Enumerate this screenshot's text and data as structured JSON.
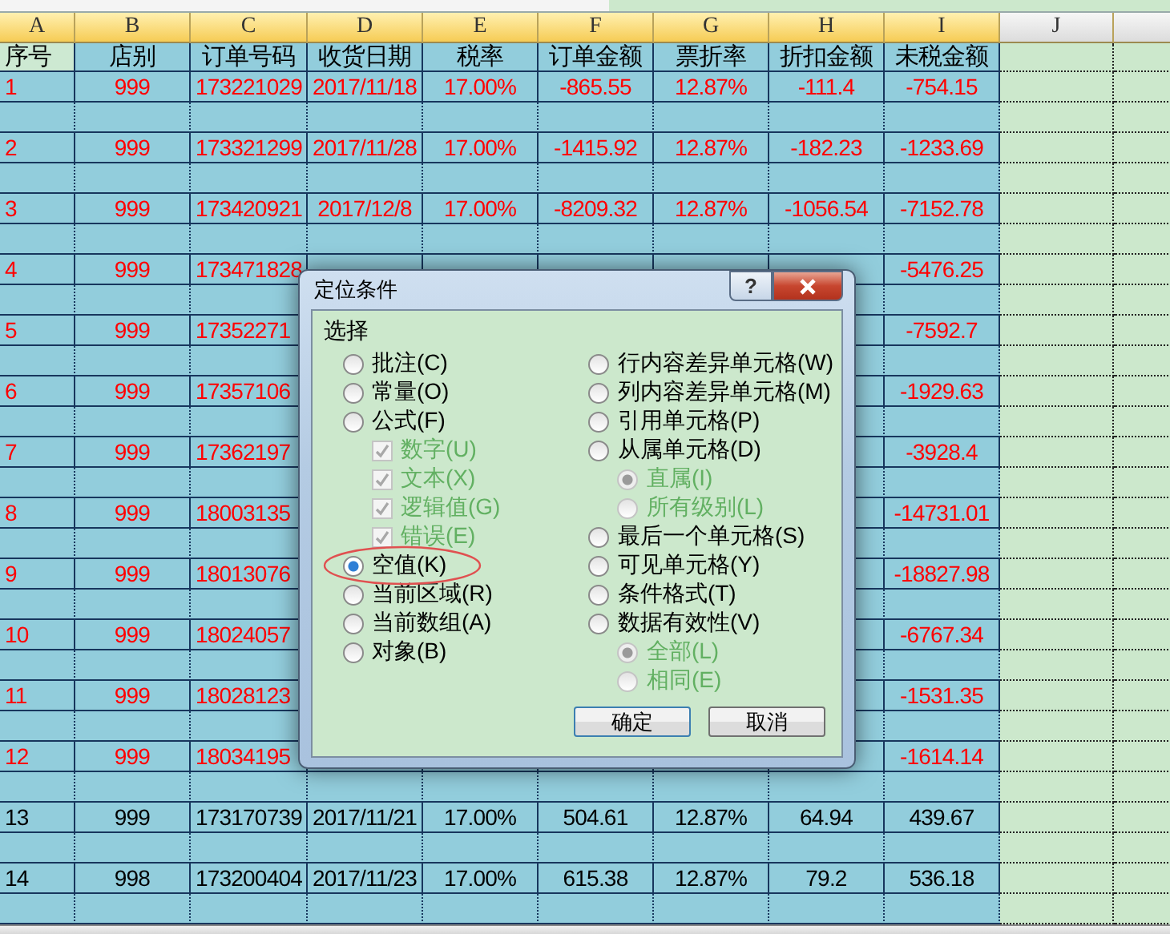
{
  "sheet": {
    "columns": [
      "A",
      "B",
      "C",
      "D",
      "E",
      "F",
      "G",
      "H",
      "I",
      "J"
    ],
    "header": [
      "序号",
      "店别",
      "订单号码",
      "收货日期",
      "税率",
      "订单金额",
      "票折率",
      "折扣金额",
      "未税金额"
    ],
    "rows": [
      {
        "color": "#ff0000",
        "cells": [
          "1",
          "999",
          "173221029",
          "2017/11/18",
          "17.00%",
          "-865.55",
          "12.87%",
          "-111.4",
          "-754.15"
        ]
      },
      {
        "color": "#ff0000",
        "cells": [
          "2",
          "999",
          "173321299",
          "2017/11/28",
          "17.00%",
          "-1415.92",
          "12.87%",
          "-182.23",
          "-1233.69"
        ]
      },
      {
        "color": "#ff0000",
        "cells": [
          "3",
          "999",
          "173420921",
          "2017/12/8",
          "17.00%",
          "-8209.32",
          "12.87%",
          "-1056.54",
          "-7152.78"
        ]
      },
      {
        "color": "#ff0000",
        "cells": [
          "4",
          "999",
          "173471828",
          null,
          null,
          null,
          null,
          null,
          "-5476.25"
        ]
      },
      {
        "color": "#ff0000",
        "cells": [
          "5",
          "999",
          "17352271",
          null,
          null,
          null,
          null,
          null,
          "-7592.7"
        ]
      },
      {
        "color": "#ff0000",
        "cells": [
          "6",
          "999",
          "17357106",
          null,
          null,
          null,
          null,
          null,
          "-1929.63"
        ]
      },
      {
        "color": "#ff0000",
        "cells": [
          "7",
          "999",
          "17362197",
          null,
          null,
          null,
          null,
          null,
          "-3928.4"
        ]
      },
      {
        "color": "#ff0000",
        "cells": [
          "8",
          "999",
          "18003135",
          null,
          null,
          null,
          null,
          null,
          "-14731.01"
        ]
      },
      {
        "color": "#ff0000",
        "cells": [
          "9",
          "999",
          "18013076",
          null,
          null,
          null,
          null,
          null,
          "-18827.98"
        ]
      },
      {
        "color": "#ff0000",
        "cells": [
          "10",
          "999",
          "18024057",
          null,
          null,
          null,
          null,
          null,
          "-6767.34"
        ]
      },
      {
        "color": "#ff0000",
        "cells": [
          "11",
          "999",
          "18028123",
          null,
          null,
          null,
          null,
          null,
          "-1531.35"
        ]
      },
      {
        "color": "#ff0000",
        "cells": [
          "12",
          "999",
          "18034195",
          null,
          null,
          null,
          null,
          null,
          "-1614.14"
        ]
      },
      {
        "color": "#000000",
        "cells": [
          "13",
          "999",
          "173170739",
          "2017/11/21",
          "17.00%",
          "504.61",
          "12.87%",
          "64.94",
          "439.67"
        ]
      },
      {
        "color": "#000000",
        "cells": [
          "14",
          "998",
          "173200404",
          "2017/11/23",
          "17.00%",
          "615.38",
          "12.87%",
          "79.2",
          "536.18"
        ]
      }
    ]
  },
  "dialog": {
    "title": "定位条件",
    "help_button": "?",
    "group": "选择",
    "left": [
      {
        "kind": "radio",
        "label": "批注(C)",
        "selected": false,
        "disabled": false
      },
      {
        "kind": "radio",
        "label": "常量(O)",
        "selected": false,
        "disabled": false
      },
      {
        "kind": "radio",
        "label": "公式(F)",
        "selected": false,
        "disabled": false,
        "children": [
          {
            "kind": "checkbox",
            "label": "数字(U)",
            "checked": true,
            "disabled": true
          },
          {
            "kind": "checkbox",
            "label": "文本(X)",
            "checked": true,
            "disabled": true
          },
          {
            "kind": "checkbox",
            "label": "逻辑值(G)",
            "checked": true,
            "disabled": true
          },
          {
            "kind": "checkbox",
            "label": "错误(E)",
            "checked": true,
            "disabled": true
          }
        ]
      },
      {
        "kind": "radio",
        "label": "空值(K)",
        "selected": true,
        "disabled": false,
        "circled": true
      },
      {
        "kind": "radio",
        "label": "当前区域(R)",
        "selected": false,
        "disabled": false
      },
      {
        "kind": "radio",
        "label": "当前数组(A)",
        "selected": false,
        "disabled": false
      },
      {
        "kind": "radio",
        "label": "对象(B)",
        "selected": false,
        "disabled": false
      }
    ],
    "right": [
      {
        "kind": "radio",
        "label": "行内容差异单元格(W)",
        "selected": false,
        "disabled": false
      },
      {
        "kind": "radio",
        "label": "列内容差异单元格(M)",
        "selected": false,
        "disabled": false
      },
      {
        "kind": "radio",
        "label": "引用单元格(P)",
        "selected": false,
        "disabled": false
      },
      {
        "kind": "radio",
        "label": "从属单元格(D)",
        "selected": false,
        "disabled": false,
        "children": [
          {
            "kind": "radio",
            "label": "直属(I)",
            "selected": true,
            "disabled": true
          },
          {
            "kind": "radio",
            "label": "所有级别(L)",
            "selected": false,
            "disabled": true
          }
        ]
      },
      {
        "kind": "radio",
        "label": "最后一个单元格(S)",
        "selected": false,
        "disabled": false
      },
      {
        "kind": "radio",
        "label": "可见单元格(Y)",
        "selected": false,
        "disabled": false
      },
      {
        "kind": "radio",
        "label": "条件格式(T)",
        "selected": false,
        "disabled": false
      },
      {
        "kind": "radio",
        "label": "数据有效性(V)",
        "selected": false,
        "disabled": false,
        "children": [
          {
            "kind": "radio",
            "label": "全部(L)",
            "selected": true,
            "disabled": true
          },
          {
            "kind": "radio",
            "label": "相同(E)",
            "selected": false,
            "disabled": true
          }
        ]
      }
    ],
    "buttons": [
      {
        "label": "确定",
        "default": true
      },
      {
        "label": "取消",
        "default": false
      }
    ]
  }
}
